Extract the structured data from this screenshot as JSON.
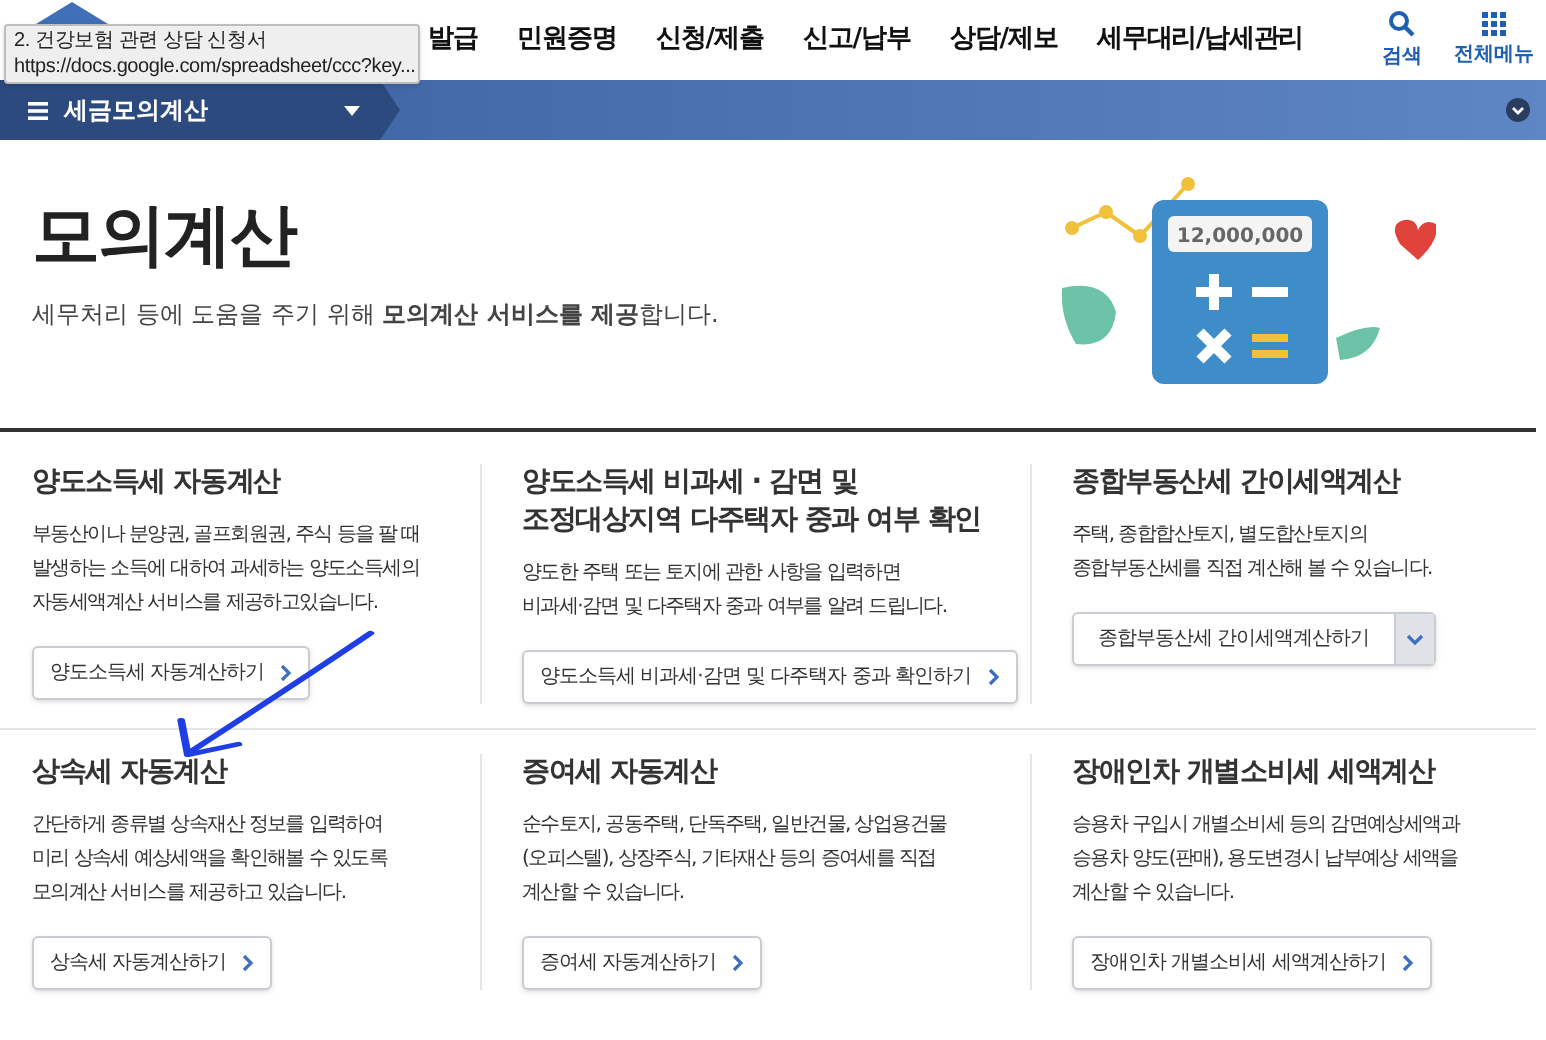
{
  "tooltip": {
    "lines": [
      "2. 건강보험 관련 상담 신청서",
      "https://docs.google.com/spreadsheet/ccc?key..."
    ]
  },
  "nav": {
    "items": [
      "발급",
      "민원증명",
      "신청/제출",
      "신고/납부",
      "상담/제보",
      "세무대리/납세관리"
    ]
  },
  "header_actions": [
    {
      "label": "검색",
      "kind": "search"
    },
    {
      "label": "전체메뉴",
      "kind": "menu"
    }
  ],
  "menu_bar": {
    "title": "세금모의계산"
  },
  "page": {
    "title": "모의계산",
    "subtitle": "세무처리 등에 도움을 주기 위해 **모의계산 서비스를 제공**합니다."
  },
  "illustration": {
    "display": "12,000,000"
  },
  "cards": [
    {
      "title": "양도소득세 자동계산",
      "description": "부동산이나 분양권, 골프회원권, 주식 등을 팔 때\n발생하는 소득에 대하여 과세하는 양도소득세의\n자동세액계산 서비스를 제공하고있습니다.",
      "button": {
        "label": "양도소득세 자동계산하기",
        "kind": "link"
      }
    },
    {
      "title": "양도소득세 비과세 · 감면 및\n조정대상지역 다주택자 중과 여부 확인",
      "description": "양도한 주택 또는 토지에 관한 사항을 입력하면\n비과세·감면 및 다주택자 중과 여부를 알려 드립니다.",
      "button": {
        "label": "양도소득세 비과세·감면 및 다주택자 중과 확인하기",
        "kind": "link"
      }
    },
    {
      "title": "종합부동산세 간이세액계산",
      "description": "주택, 종합합산토지, 별도합산토지의\n종합부동산세를 직접 계산해 볼 수 있습니다.",
      "button": {
        "label": "종합부동산세 간이세액계산하기",
        "kind": "dropdown"
      }
    },
    {
      "title": "상속세 자동계산",
      "description": "간단하게 종류별 상속재산 정보를 입력하여\n미리 상속세 예상세액을 확인해볼 수 있도록\n모의계산 서비스를 제공하고 있습니다.",
      "button": {
        "label": "상속세 자동계산하기",
        "kind": "link"
      }
    },
    {
      "title": "증여세 자동계산",
      "description": "순수토지, 공동주택, 단독주택, 일반건물, 상업용건물\n(오피스텔), 상장주식, 기타재산 등의 증여세를 직접\n계산할 수 있습니다.",
      "button": {
        "label": "증여세 자동계산하기",
        "kind": "link"
      }
    },
    {
      "title": "장애인차 개별소비세 세액계산",
      "description": "승용차 구입시 개별소비세 등의 감면예상세액과\n승용차 양도(판매), 용도변경시 납부예상 세액을\n계산할 수 있습니다.",
      "button": {
        "label": "장애인차 개별소비세 세액계산하기",
        "kind": "link"
      }
    }
  ]
}
